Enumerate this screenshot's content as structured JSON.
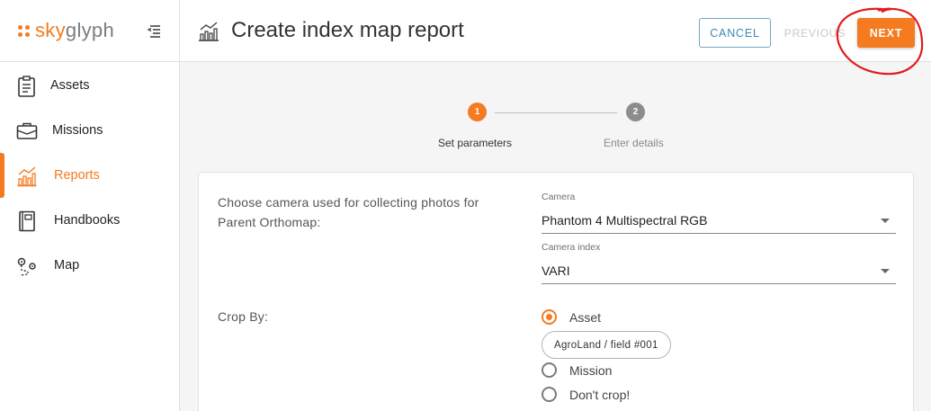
{
  "app": {
    "logo_part1": "sky",
    "logo_part2": "glyph",
    "brand_color": "#f47b20"
  },
  "sidebar": {
    "items": [
      {
        "label": "Assets",
        "icon": "clipboard-icon",
        "active": false
      },
      {
        "label": "Missions",
        "icon": "briefcase-icon",
        "active": false
      },
      {
        "label": "Reports",
        "icon": "bar-chart-icon",
        "active": true
      },
      {
        "label": "Handbooks",
        "icon": "book-icon",
        "active": false
      },
      {
        "label": "Map",
        "icon": "map-route-icon",
        "active": false
      }
    ]
  },
  "header": {
    "title": "Create index map report",
    "cancel_label": "CANCEL",
    "previous_label": "PREVIOUS",
    "next_label": "NEXT"
  },
  "stepper": {
    "steps": [
      {
        "number": "1",
        "label": "Set parameters",
        "active": true
      },
      {
        "number": "2",
        "label": "Enter details",
        "active": false
      }
    ]
  },
  "form": {
    "camera_prompt": "Choose camera used for collecting photos for Parent Orthomap:",
    "camera": {
      "label": "Camera",
      "value": "Phantom 4 Multispectral RGB"
    },
    "camera_index": {
      "label": "Camera index",
      "value": "VARI"
    },
    "crop_label": "Crop By:",
    "crop_options": [
      {
        "label": "Asset",
        "checked": true
      },
      {
        "label": "Mission",
        "checked": false
      },
      {
        "label": "Don't crop!",
        "checked": false
      }
    ],
    "asset_chip": "AgroLand / field #001"
  }
}
